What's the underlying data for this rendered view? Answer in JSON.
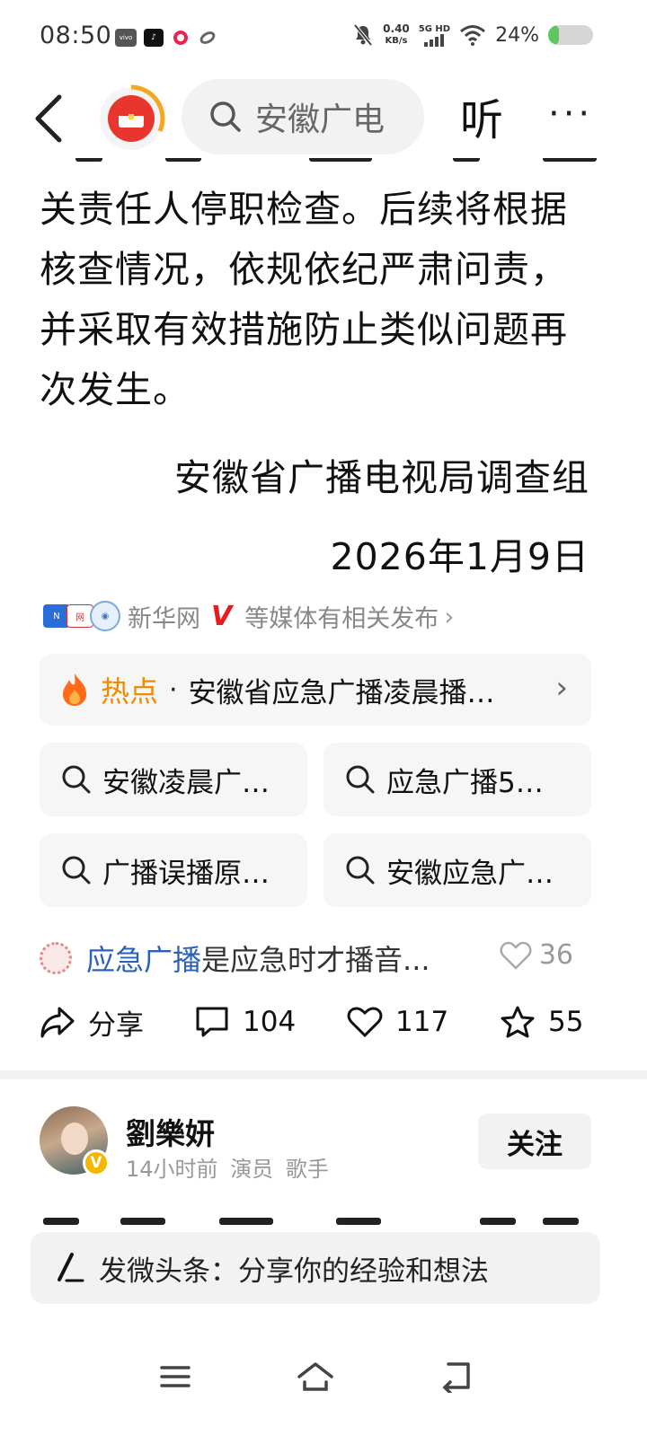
{
  "status_bar": {
    "time": "08:50",
    "net_speed_value": "0.40",
    "net_speed_unit": "KB/s",
    "signal_label": "5G HD",
    "battery_percent": "24%",
    "battery_level": 0.24,
    "app_icons": [
      "vivo-icon",
      "tiktok-icon",
      "red-app-icon",
      "ring-app-icon"
    ]
  },
  "nav": {
    "search_text": "安徽广电",
    "listen_label": "听",
    "more_label": "···"
  },
  "article": {
    "paragraph": "关责任人停职检查。后续将根据核查情况，依规依纪严肃问责，并采取有效措施防止类似问题再次发生。",
    "signature": "安徽省广播电视局调查组",
    "date": "2026年1月9日"
  },
  "media": {
    "name": "新华网",
    "verified_mark": "V",
    "rest": "等媒体有相关发布",
    "chevron": "›"
  },
  "hot": {
    "label": "热点",
    "dot": "·",
    "text": "安徽省应急广播凌晨播…",
    "chevron": "›"
  },
  "suggestions": [
    {
      "label": "安徽凌晨广…"
    },
    {
      "label": "应急广播5…"
    },
    {
      "label": "广播误播原…"
    },
    {
      "label": "安徽应急广…"
    }
  ],
  "comment": {
    "keyword": "应急广播",
    "text": "是应急时才播音...",
    "likes": "36"
  },
  "actions": {
    "share_label": "分享",
    "comments": "104",
    "likes": "117",
    "favorites": "55"
  },
  "next_post": {
    "author": "劉樂妍",
    "time": "14小时前",
    "tags": "演员 歌手",
    "follow_label": "关注"
  },
  "compose": {
    "placeholder": "发微头条：分享你的经验和想法"
  },
  "colors": {
    "accent_orange": "#f08a00",
    "keyword_blue": "#2a62b8",
    "verified_red": "#e61b1b",
    "battery_green": "#5fc65f"
  }
}
